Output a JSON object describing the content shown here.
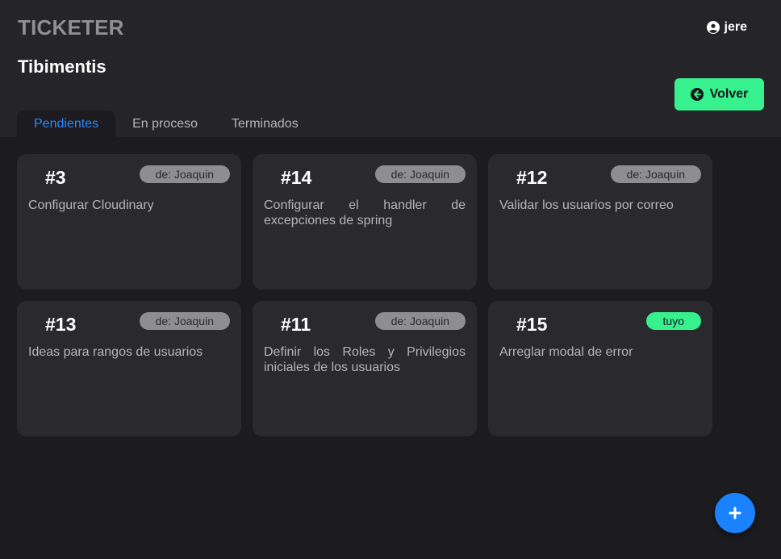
{
  "app": {
    "title": "TICKETER"
  },
  "user": {
    "name": "jere",
    "icon": "user-circle-icon"
  },
  "project": {
    "title": "Tibimentis"
  },
  "actions": {
    "back_label": "Volver",
    "back_icon": "arrow-left-circle-icon",
    "add_icon": "plus-icon"
  },
  "tabs": [
    {
      "label": "Pendientes",
      "active": true
    },
    {
      "label": "En proceso",
      "active": false
    },
    {
      "label": "Terminados",
      "active": false
    }
  ],
  "tickets": [
    {
      "number": "#3",
      "badge": "de: Joaquin",
      "text": "Configurar Cloudinary"
    },
    {
      "number": "#14",
      "badge": "de: Joaquin",
      "text": "Configurar el handler de excepciones de spring"
    },
    {
      "number": "#12",
      "badge": "de: Joaquin",
      "text": "Validar los usuarios por correo"
    },
    {
      "number": "#13",
      "badge": "de: Joaquin",
      "text": "Ideas para rangos de usuarios"
    },
    {
      "number": "#11",
      "badge": "de: Joaquin",
      "text": "Definir los Roles y Privilegios iniciales de los usuarios"
    },
    {
      "number": "#15",
      "badge": "tuyo",
      "text": "Arreglar modal de error"
    }
  ],
  "colors": {
    "background": "#1b1b20",
    "header": "#252529",
    "card": "#29292e",
    "accent_green": "#37f08e",
    "accent_blue": "#1a82ff",
    "active_tab_text": "#2f86ff",
    "badge_gray": "#8e8e92"
  }
}
